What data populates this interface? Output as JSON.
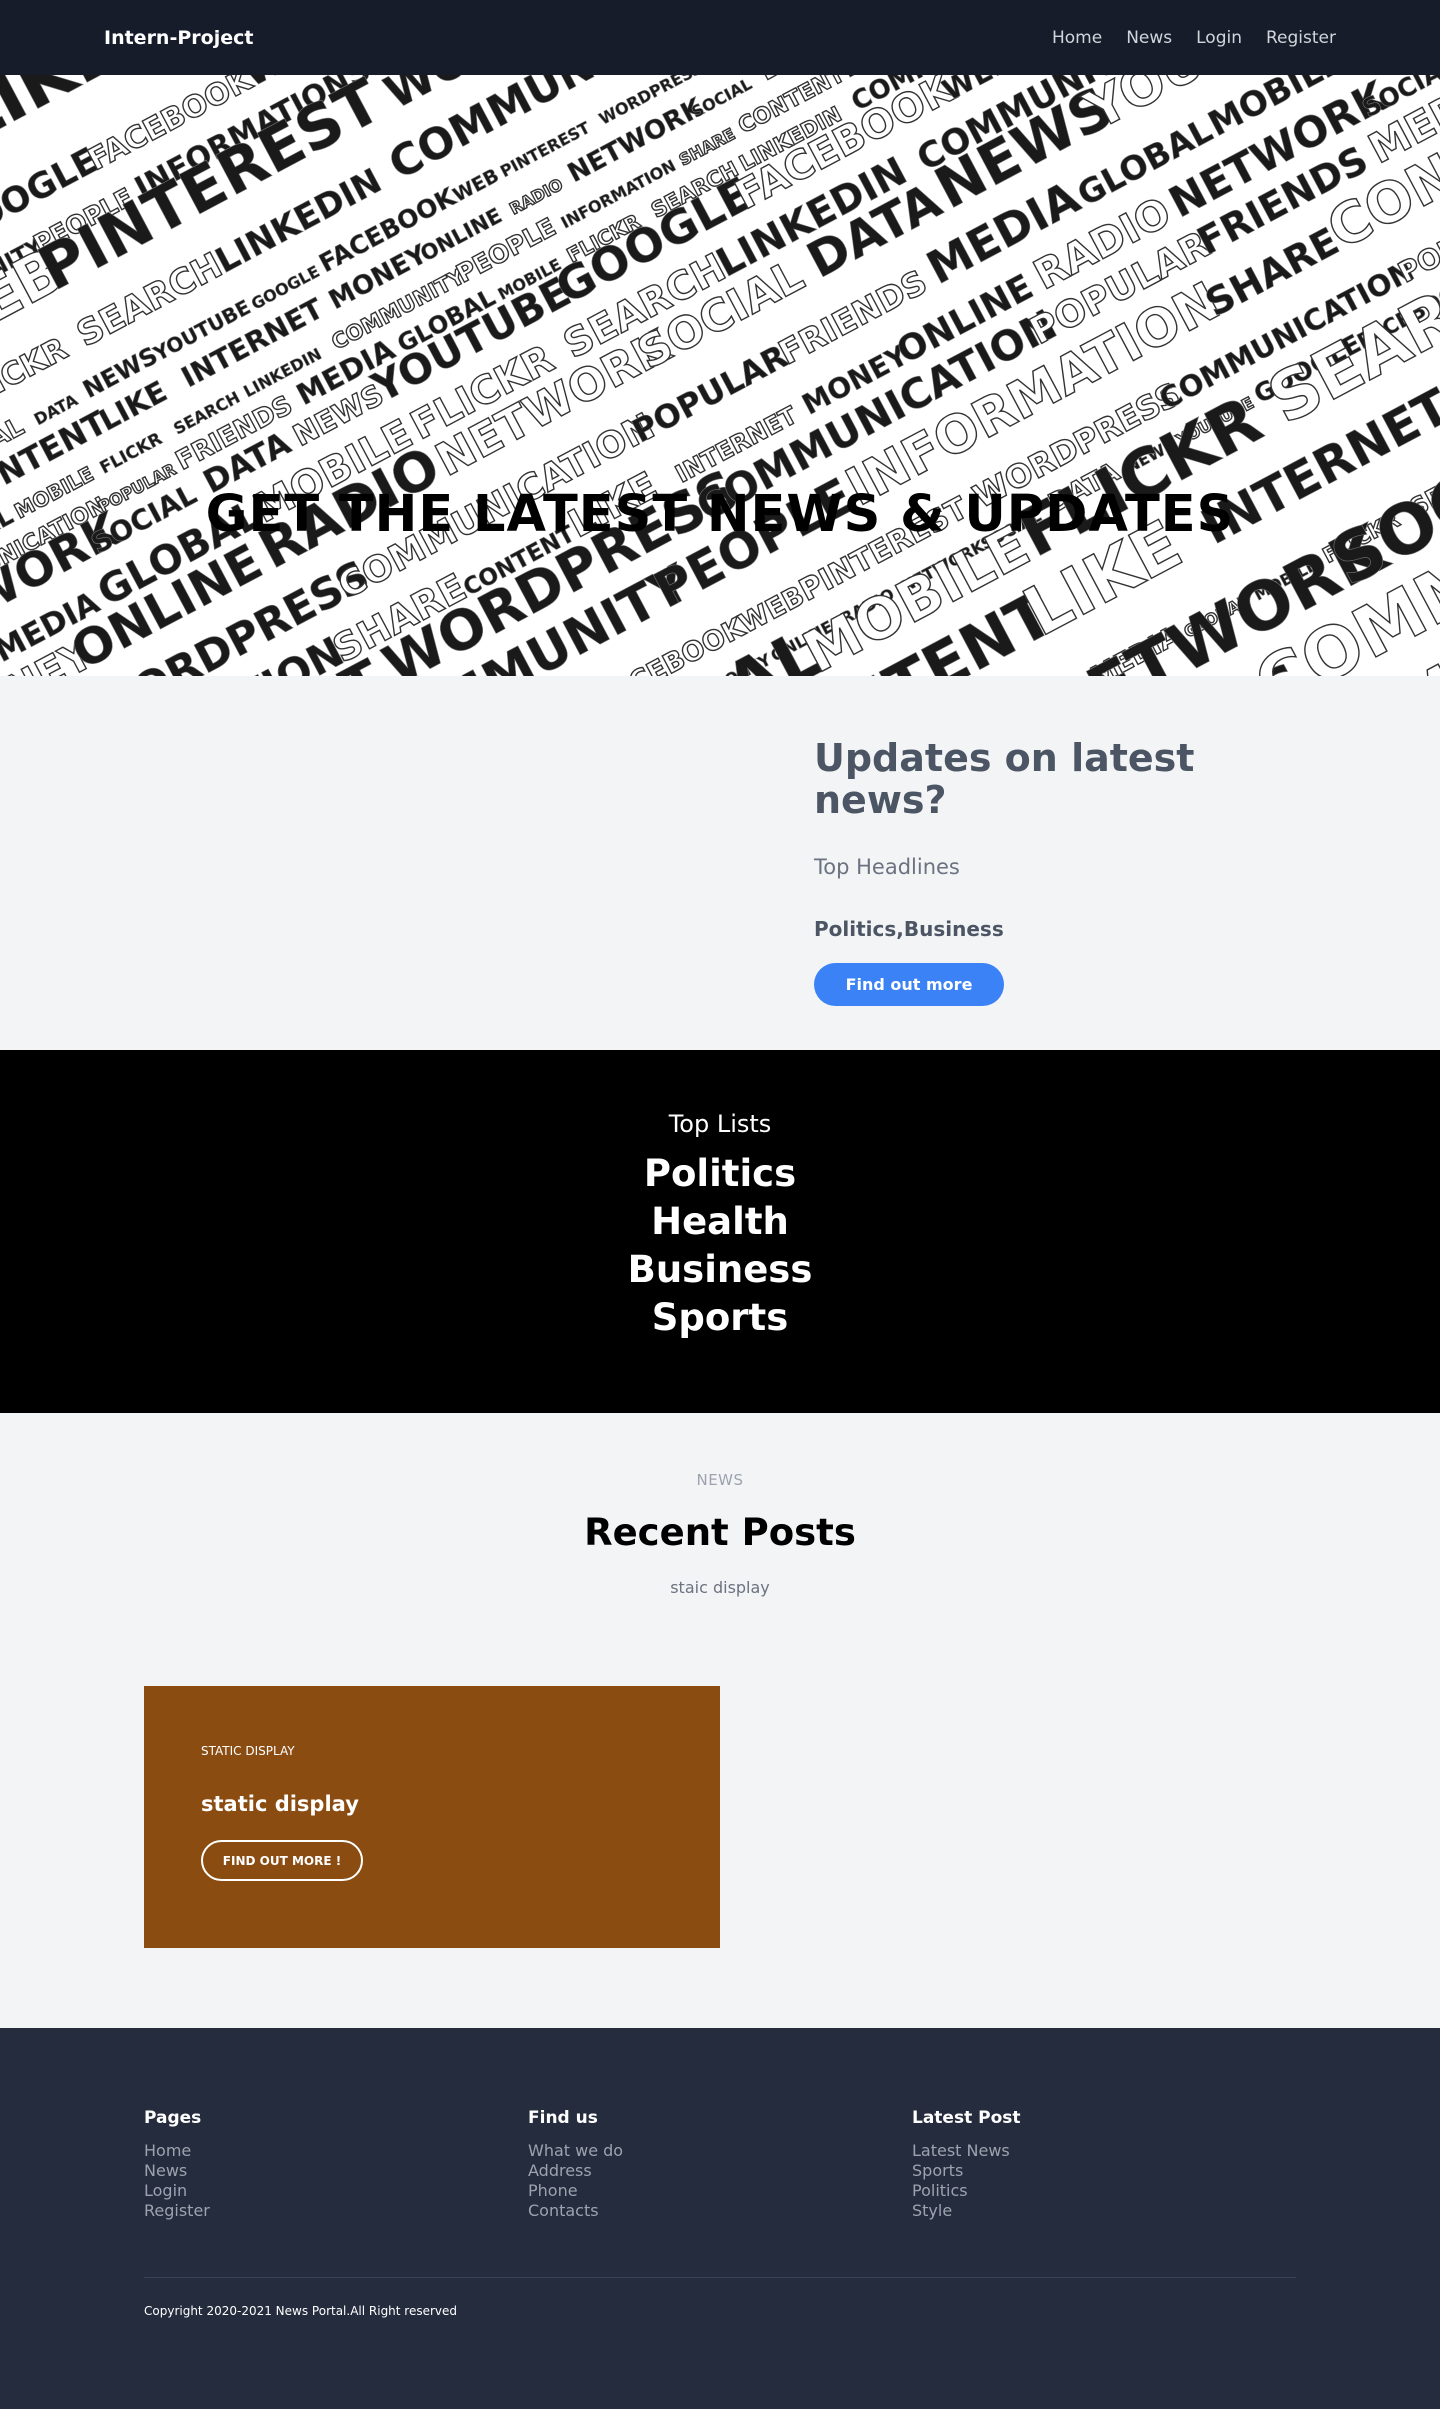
{
  "nav": {
    "brand": "Intern-Project",
    "links": [
      "Home",
      "News",
      "Login",
      "Register"
    ]
  },
  "hero": {
    "title": "GET THE LATEST NEWS & UPDATES",
    "background_words": [
      "POPULAR",
      "FRIENDS",
      "MEDIA",
      "GLOBAL",
      "MOBILE",
      "FLICKR",
      "SEARCH",
      "LINKEDIN",
      "COMMUNITY",
      "PEOPLE",
      "INFORMATION",
      "SHARE",
      "CONTENT",
      "LIKE",
      "INTERNET",
      "MONEY",
      "ONLINE",
      "RADIO",
      "NETWORK",
      "SOCIAL",
      "DATA",
      "NEWS",
      "YOUTUBE",
      "GOOGLE",
      "FACEBOOK",
      "WEB",
      "PINTEREST",
      "WORDPRESS",
      "COMMUNICATION"
    ]
  },
  "updates": {
    "title": "Updates on latest news?",
    "subtitle": "Top Headlines",
    "categories": "Politics,Business",
    "button": "Find out more"
  },
  "toplists": {
    "title": "Top Lists",
    "items": [
      "Politics",
      "Health",
      "Business",
      "Sports"
    ]
  },
  "recent": {
    "eyebrow": "NEWS",
    "title": "Recent Posts",
    "subtitle": "staic display",
    "card": {
      "eyebrow": "STATIC DISPLAY",
      "title": "static display",
      "button": "FIND OUT MORE !"
    }
  },
  "footer": {
    "columns": [
      {
        "heading": "Pages",
        "links": [
          "Home",
          "News",
          "Login",
          "Register"
        ]
      },
      {
        "heading": "Find us",
        "links": [
          "What we do",
          "Address",
          "Phone",
          "Contacts"
        ]
      },
      {
        "heading": "Latest Post",
        "links": [
          "Latest News",
          "Sports",
          "Politics",
          "Style"
        ]
      }
    ],
    "copyright": "Copyright 2020-2021 News Portal.All Right reserved"
  },
  "colors": {
    "navbar": "#171c2b",
    "accent_blue": "#3b82f6",
    "card_brown": "#8b4c12",
    "footer": "#252c3e",
    "toplists_bg": "#000000"
  }
}
